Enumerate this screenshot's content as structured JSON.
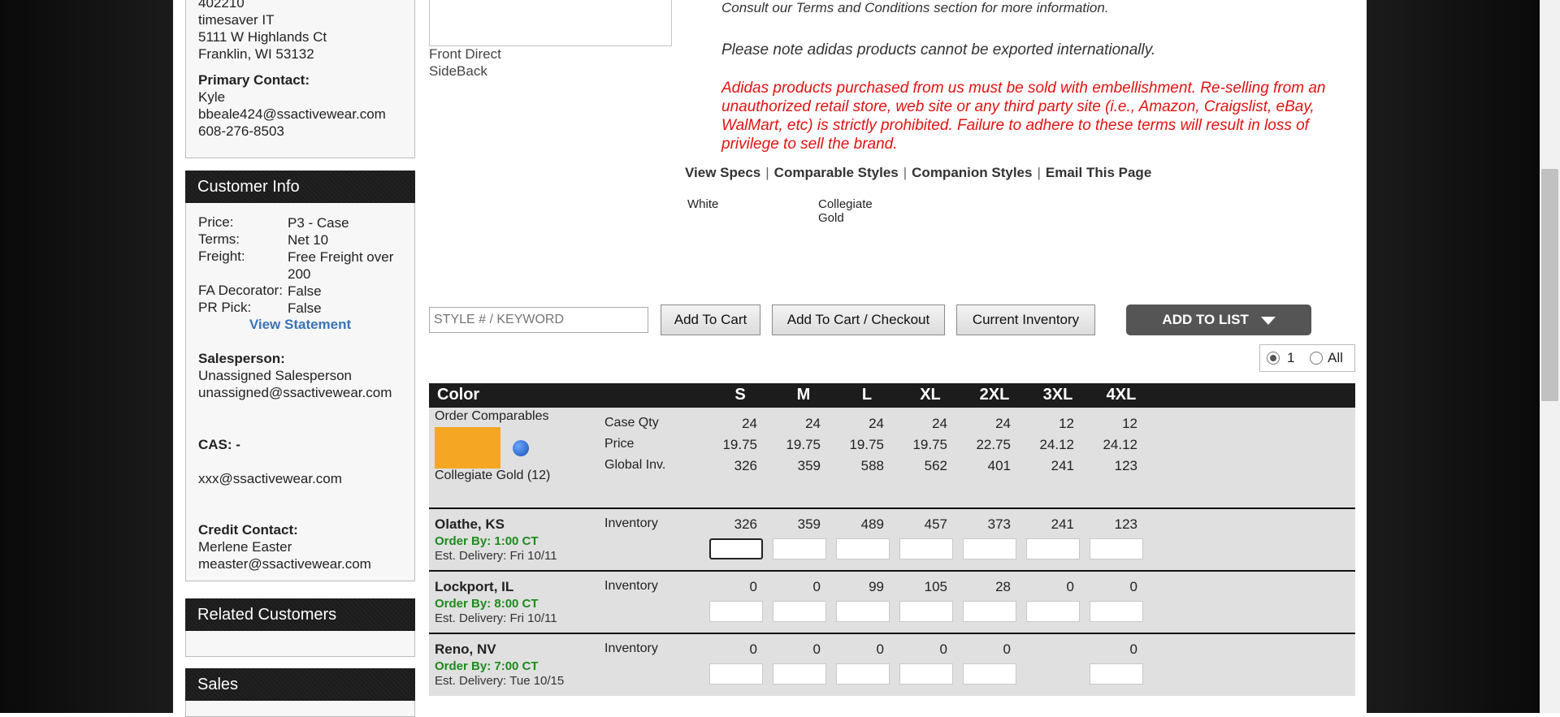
{
  "account": {
    "id_partial": "402210",
    "company": "timesaver IT",
    "address1": "5111 W Highlands Ct",
    "address2": "Franklin, WI 53132",
    "primary_contact_label": "Primary Contact:",
    "primary_contact_name": "Kyle",
    "primary_contact_email": "bbeale424@ssactivewear.com",
    "primary_contact_phone": "608-276-8503"
  },
  "customer_info": {
    "title": "Customer Info",
    "rows": [
      {
        "label": "Price:",
        "value": "P3 - Case"
      },
      {
        "label": "Terms:",
        "value": "Net 10"
      },
      {
        "label": "Freight:",
        "value": "Free Freight over 200"
      },
      {
        "label": "FA Decorator:",
        "value": "False"
      },
      {
        "label": "PR Pick:",
        "value": "False"
      }
    ],
    "view_statement": "View Statement",
    "salesperson_label": "Salesperson:",
    "salesperson_name": "Unassigned Salesperson",
    "salesperson_email": "unassigned@ssactivewear.com",
    "cas_label": "CAS: -",
    "cas_email": "xxx@ssactivewear.com",
    "credit_label": "Credit Contact:",
    "credit_name": "Merlene Easter",
    "credit_email": "measter@ssactivewear.com"
  },
  "related_customers": {
    "title": "Related Customers"
  },
  "sales": {
    "title": "Sales"
  },
  "product": {
    "image_caption_1": "Front Direct",
    "image_caption_2": "SideBack",
    "notice_terms": "Consult our Terms and Conditions section for more information.",
    "notice_export": "Please note adidas products cannot be exported internationally.",
    "notice_red": "Adidas products purchased from us must be sold with embellishment. Re-selling from an unauthorized retail store, web site or any third party site (i.e., Amazon, Craigslist, eBay, WalMart, etc) is strictly prohibited. Failure to adhere to these terms will result in loss of privilege to sell the brand.",
    "links": [
      "View Specs",
      "Comparable Styles",
      "Companion Styles",
      "Email This Page"
    ],
    "link_sep": "|",
    "swatches": [
      "White",
      "Collegiate Gold"
    ]
  },
  "toolbar": {
    "search_placeholder": "STYLE # / KEYWORD",
    "add_to_cart": "Add To Cart",
    "add_to_cart_checkout": "Add To Cart / Checkout",
    "current_inventory": "Current Inventory",
    "add_to_list": "ADD TO LIST",
    "qty_option_1": "1",
    "qty_option_all": "All"
  },
  "table": {
    "color_header": "Color",
    "sizes": [
      "S",
      "M",
      "L",
      "XL",
      "2XL",
      "3XL",
      "4XL"
    ],
    "order_comparables": "Order Comparables",
    "color_name": "Collegiate Gold (12)",
    "color_hex": "#f5a623",
    "labels": {
      "case_qty": "Case Qty",
      "price": "Price",
      "global_inv": "Global Inv.",
      "inventory": "Inventory"
    },
    "case_qty": [
      "24",
      "24",
      "24",
      "24",
      "24",
      "12",
      "12"
    ],
    "price": [
      "19.75",
      "19.75",
      "19.75",
      "19.75",
      "22.75",
      "24.12",
      "24.12"
    ],
    "global_inv": [
      "326",
      "359",
      "588",
      "562",
      "401",
      "241",
      "123"
    ],
    "warehouses": [
      {
        "name": "Olathe, KS",
        "order_by": "Order By: 1:00 CT",
        "delivery": "Est. Delivery: Fri 10/11",
        "inventory": [
          "326",
          "359",
          "489",
          "457",
          "373",
          "241",
          "123"
        ]
      },
      {
        "name": "Lockport, IL",
        "order_by": "Order By: 8:00 CT",
        "delivery": "Est. Delivery: Fri 10/11",
        "inventory": [
          "0",
          "0",
          "99",
          "105",
          "28",
          "0",
          "0"
        ]
      },
      {
        "name": "Reno, NV",
        "order_by": "Order By: 7:00 CT",
        "delivery": "Est. Delivery: Tue 10/15",
        "inventory": [
          "0",
          "0",
          "0",
          "0",
          "0",
          "",
          "0"
        ]
      }
    ]
  }
}
